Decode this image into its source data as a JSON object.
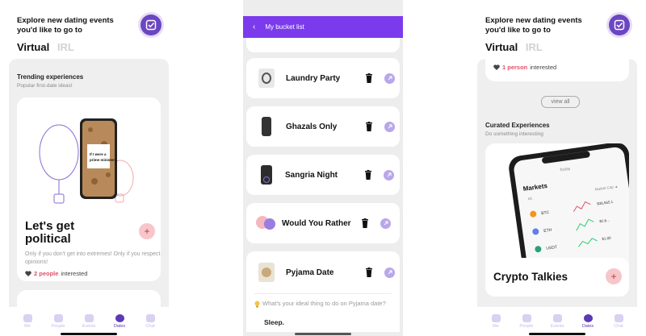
{
  "left": {
    "header": {
      "title": "Explore new dating events you'd like to go to"
    },
    "tabs": {
      "virtual": "Virtual",
      "irl": "IRL"
    },
    "trending": {
      "title": "Trending experiences",
      "subtitle": "Popular first-date ideas!"
    },
    "phone_mock": {
      "line1": "If I were a",
      "line2": "prime minister..."
    },
    "card": {
      "title": "Let's get political",
      "plus": "+",
      "description": "Only if you don't get into extremes! Only if you respect opinions!",
      "count": "2 people",
      "interested": "interested"
    }
  },
  "middle": {
    "header": {
      "back": "‹",
      "title": "My bucket list"
    },
    "items": [
      {
        "label": "Laundry Party"
      },
      {
        "label": "Ghazals Only"
      },
      {
        "label": "Sangria Night"
      },
      {
        "label": "Would You Rather"
      },
      {
        "label": "Pyjama Date"
      }
    ],
    "question": "What's your ideal thing to do on Pyjama date?",
    "answer": "Sleep."
  },
  "right": {
    "header": {
      "title": "Explore new dating events you'd like to go to"
    },
    "tabs": {
      "virtual": "Virtual",
      "irl": "IRL"
    },
    "top_interest": {
      "count": "1 person",
      "interested": "interested"
    },
    "view_all": "view all",
    "curated": {
      "title": "Curated Experiences",
      "subtitle": "Do something interesting"
    },
    "phone_mock": {
      "today": "Today",
      "markets": "Markets",
      "all": "All",
      "market_cap": "Market Cap ▲",
      "btc": "BTC",
      "eth": "ETH",
      "usdt": "USDT",
      "btc_val": "$36,565.1",
      "eth_val": "$2,6...",
      "usdt_val": "$1.00"
    },
    "card": {
      "title": "Crypto Talkies",
      "plus": "+"
    }
  },
  "nav": [
    "Me",
    "People",
    "Events",
    "Dates",
    "Chat"
  ],
  "colors": {
    "accent": "#6b46c1",
    "header_purple": "#7c3aed",
    "pink": "#e0506a"
  }
}
